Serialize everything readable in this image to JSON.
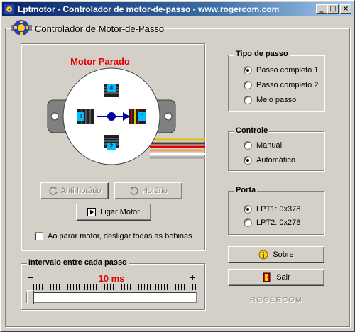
{
  "window": {
    "title": "Lptmotor - Controlador de motor-de-passo - www.rogercom.com",
    "minimize_label": "_",
    "maximize_label": "□",
    "close_label": "×"
  },
  "main_group": {
    "title": "Controlador de Motor-de-Passo"
  },
  "motor": {
    "status": "Motor Parado",
    "coils": [
      "1",
      "2",
      "3",
      "4"
    ],
    "colors": {
      "status": "#e00000",
      "coil_active": "#e00000",
      "coil_label_bg": "#00c0ff",
      "rotor": "#0000a0"
    }
  },
  "buttons": {
    "anti_horario": "Anti-horário",
    "horario": "Horário",
    "ligar_motor": "Ligar Motor",
    "sobre": "Sobre",
    "sair": "Sair"
  },
  "checkbox": {
    "label": "Ao parar motor, desligar todas as bobinas",
    "checked": false
  },
  "tipo_passo": {
    "title": "Tipo de passo",
    "options": [
      {
        "label": "Passo completo 1",
        "selected": true
      },
      {
        "label": "Passo completo 2",
        "selected": false
      },
      {
        "label": "Meio passo",
        "selected": false
      }
    ]
  },
  "controle": {
    "title": "Controle",
    "options": [
      {
        "label": "Manual",
        "selected": false
      },
      {
        "label": "Automático",
        "selected": true
      }
    ]
  },
  "porta": {
    "title": "Porta",
    "options": [
      {
        "label": "LPT1: 0x378",
        "selected": true
      },
      {
        "label": "LPT2: 0x278",
        "selected": false
      }
    ]
  },
  "intervalo": {
    "title": "Intervalo entre cada passo",
    "minus_label": "−",
    "plus_label": "+",
    "value_text": "10 ms",
    "slider_fraction": 0.0
  },
  "brand": "ROGERCOM"
}
